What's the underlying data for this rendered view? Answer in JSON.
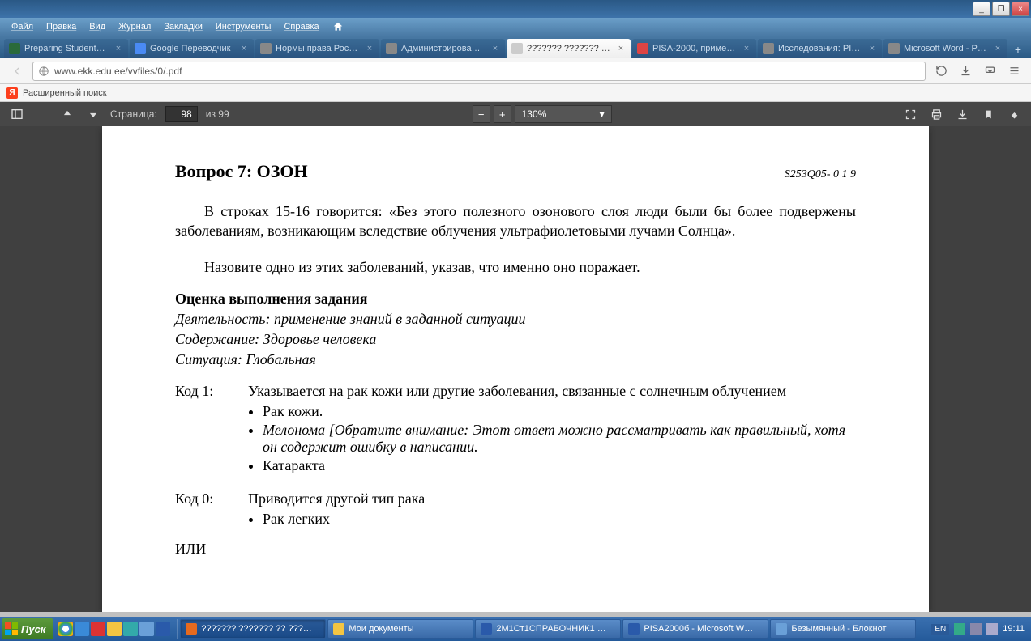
{
  "window": {
    "minimize": "_",
    "maximize": "❐",
    "close": "×"
  },
  "menu": {
    "items": [
      "Файл",
      "Правка",
      "Вид",
      "Журнал",
      "Закладки",
      "Инструменты",
      "Справка"
    ]
  },
  "tabs": [
    {
      "label": "Preparing Student…",
      "color": "#2a6a3a"
    },
    {
      "label": "Google Переводчик",
      "color": "#4a8af4"
    },
    {
      "label": "Нормы права Рос…",
      "color": "#888"
    },
    {
      "label": "Администрирова…",
      "color": "#888"
    },
    {
      "label": "??????? ??????? ?? ????…",
      "color": "#ccc",
      "active": true
    },
    {
      "label": "PISA-2000, приме…",
      "color": "#d44"
    },
    {
      "label": "Исследования: PISA…",
      "color": "#888"
    },
    {
      "label": "Microsoft Word - P…",
      "color": "#888"
    }
  ],
  "address": {
    "url": "www.ekk.edu.ee/vvfiles/0/.pdf"
  },
  "secondbar": {
    "label": "Расширенный поиск"
  },
  "pdf": {
    "page_label": "Страница:",
    "page_current": "98",
    "page_total": "из 99",
    "zoom": "130%",
    "document": {
      "title": "Вопрос 7: ОЗОН",
      "code": "S253Q05- 0 1 9",
      "para1": "В строках 15-16 говорится: «Без этого полезного озонового слоя люди были бы более подвержены заболеваниям, возникающим вследствие облучения ультрафиолетовыми лучами Солнца».",
      "para2": "Назовите одно из этих заболеваний, указав, что именно оно поражает.",
      "section": "Оценка выполнения задания",
      "activity": "Деятельность: применение знаний в заданной ситуации",
      "content": "Содержание: Здоровье человека",
      "situation": "Ситуация: Глобальная",
      "code1_label": "Код 1:",
      "code1_text": "Указывается на рак кожи или другие заболевания, связанные с солнечным облучением",
      "code1_bullets": [
        "Рак кожи.",
        "Мелонома [Обратите внимание: Этот ответ можно рассматривать как правильный, хотя он содержит ошибку в написании.",
        "Катаракта"
      ],
      "code0_label": "Код 0:",
      "code0_text": "Приводится другой тип рака",
      "code0_bullets": [
        "Рак легких"
      ],
      "or": "ИЛИ"
    }
  },
  "taskbar": {
    "start": "Пуск",
    "items": [
      {
        "label": "??????? ??????? ?? ???…",
        "color": "#e66a1f",
        "active": true
      },
      {
        "label": "Мои документы",
        "color": "#f4c542"
      },
      {
        "label": "2М1Ст1СПРАВОЧНИК1 …",
        "color": "#2a5aaa"
      },
      {
        "label": "PISA2000б - Microsoft W…",
        "color": "#2a5aaa"
      },
      {
        "label": "Безымянный - Блокнот",
        "color": "#6aa0d8"
      }
    ],
    "lang": "EN",
    "clock": "19:11"
  }
}
